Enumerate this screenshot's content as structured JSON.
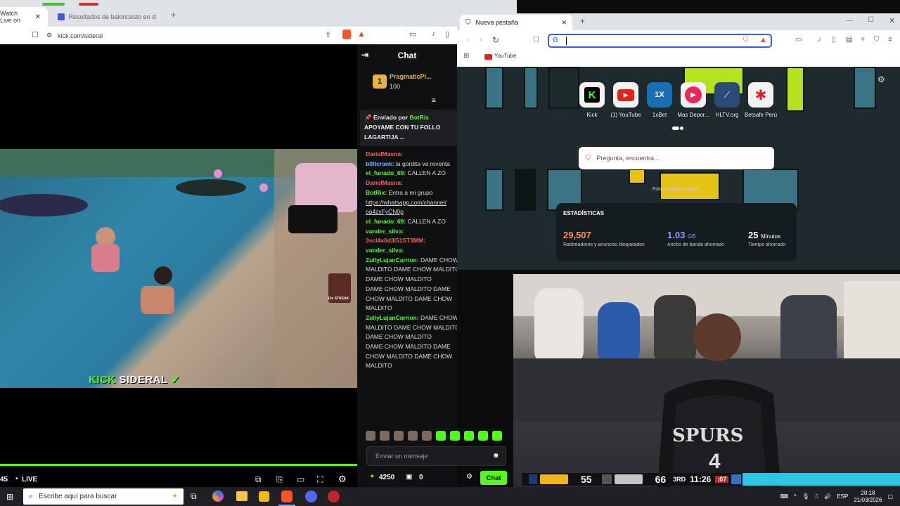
{
  "left_browser": {
    "tabs": [
      {
        "label": "Watch Live on"
      },
      {
        "label": "Resultados de baloncesto en directo"
      }
    ],
    "url": "kick.com/sideral"
  },
  "stream": {
    "watermark_kick": "KICK",
    "watermark_name": "SIDERAL",
    "time": "45",
    "live_label": "LIVE",
    "streak_label": "13x STREAK"
  },
  "chat": {
    "title": "Chat",
    "top_user": "PragmaticPl...",
    "top_user_count": "100",
    "pinned_by_prefix": "Enviado por",
    "pinned_by_user": "BotRix",
    "pinned_text": "APOYAME CON TU FOLLO LAGARTIJA ...",
    "messages": [
      {
        "user": "DarielMasna:",
        "color": "#ff5c5c",
        "text": ""
      },
      {
        "user": "b0ltcrank:",
        "color": "#7fb2ff",
        "text": "la gordita va reventa"
      },
      {
        "user": "el_funado_69:",
        "color": "#53fc18",
        "text": "CALLEN A ZO"
      },
      {
        "user": "DarielMasna:",
        "color": "#ff5c5c",
        "text": ""
      },
      {
        "user": "BotRix:",
        "color": "#53fc18",
        "text": "Entra a mi grupo"
      },
      {
        "user": "",
        "color": "#fff",
        "text": "https://whatsapp.com/channel/"
      },
      {
        "user": "",
        "color": "#fff",
        "text": "oa4zxFyCN0p"
      },
      {
        "user": "el_funado_69:",
        "color": "#53fc18",
        "text": "CALLEN A ZO"
      },
      {
        "user": "vander_silva:",
        "color": "#53fc18",
        "text": ""
      },
      {
        "user": "3scl4v0d3l51ST3MM:",
        "color": "#ff5c5c",
        "text": ""
      },
      {
        "user": "vander_silva:",
        "color": "#53fc18",
        "text": ""
      },
      {
        "user": "ZullyLujanCarrion:",
        "color": "#53fc18",
        "text": "DAME CHOW"
      },
      {
        "user": "",
        "color": "#fff",
        "text": "MALDITO DAME CHOW MALDITO"
      },
      {
        "user": "",
        "color": "#fff",
        "text": "DAME CHOW MALDITO"
      },
      {
        "user": "",
        "color": "#fff",
        "text": "DAME CHOW MALDITO DAME"
      },
      {
        "user": "",
        "color": "#fff",
        "text": "CHOW MALDITO DAME CHOW"
      },
      {
        "user": "",
        "color": "#fff",
        "text": "MALDITO"
      },
      {
        "user": "ZullyLujanCarrion:",
        "color": "#53fc18",
        "text": "DAME CHOW"
      },
      {
        "user": "",
        "color": "#fff",
        "text": "MALDITO DAME CHOW MALDITO"
      },
      {
        "user": "",
        "color": "#fff",
        "text": "DAME CHOW MALDITO"
      },
      {
        "user": "",
        "color": "#fff",
        "text": "DAME CHOW MALDITO DAME"
      },
      {
        "user": "",
        "color": "#fff",
        "text": "CHOW MALDITO DAME CHOW"
      },
      {
        "user": "",
        "color": "#fff",
        "text": "MALDITO"
      }
    ],
    "input_placeholder": "Enviar un mensaje",
    "points": "4250",
    "second_count": "0",
    "chat_button": "Chat"
  },
  "right_browser": {
    "tab_label": "Nueva pestaña",
    "bookmark": "YouTube",
    "shortcuts": [
      {
        "label": "Kick",
        "icon": "kick-icon",
        "color": "#53fc18"
      },
      {
        "label": "(1) YouTube",
        "icon": "youtube-icon",
        "color": "#e62117"
      },
      {
        "label": "1xBet",
        "icon": "1xbet-icon",
        "color": "#1a6fb3"
      },
      {
        "label": "Mas Depor...",
        "icon": "play-icon",
        "color": "#e8275a"
      },
      {
        "label": "HLTV.org",
        "icon": "hltv-icon",
        "color": "#2b4a7a"
      },
      {
        "label": "Betsafe Perú",
        "icon": "betsafe-icon",
        "color": "#d8222a"
      }
    ],
    "ask_placeholder": "Pregunta, encuentra...",
    "photo_credit": "Foto de Blanco Shots",
    "stats": {
      "title": "ESTADÍSTICAS",
      "blocked_value": "29,507",
      "blocked_label": "Rastreadores y anuncios bloqueados",
      "bandwidth_value": "1.03",
      "bandwidth_unit": "GB",
      "bandwidth_label": "Ancho de banda ahorrado",
      "time_value": "25",
      "time_unit": "Minutos",
      "time_label": "Tiempo ahorrado"
    }
  },
  "basketball": {
    "home_score": "55",
    "away_score": "66",
    "quarter": "3RD",
    "clock": "11:26",
    "shot_clock": ":07",
    "jersey_text": "SPURS",
    "jersey_number": "4"
  },
  "taskbar": {
    "search_placeholder": "Escribe aquí para buscar",
    "lang": "ESP",
    "time": "20:18",
    "date": "21/03/2026"
  }
}
